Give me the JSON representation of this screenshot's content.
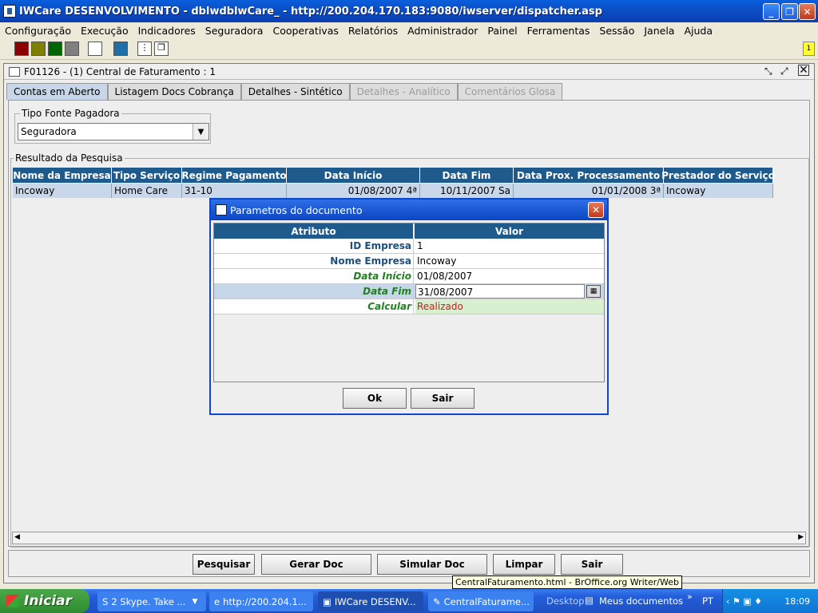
{
  "window": {
    "title": "IWCare DESENVOLVIMENTO - dblwdblwCare_ - http://200.204.170.183:9080/iwserver/dispatcher.asp"
  },
  "menu": [
    "Configuração",
    "Execução",
    "Indicadores",
    "Seguradora",
    "Cooperativas",
    "Relatórios",
    "Administrador",
    "Painel",
    "Ferramentas",
    "Sessão",
    "Janela",
    "Ajuda"
  ],
  "toolbar": {
    "badge": "1",
    "colors": [
      "#8b0000",
      "#808000",
      "#006400",
      "#808080",
      "#ffffff",
      "#1e6fa8"
    ]
  },
  "frame": {
    "title": "F01126 - (1) Central de Faturamento : 1"
  },
  "tabs": [
    {
      "label": "Contas em Aberto",
      "state": "active"
    },
    {
      "label": "Listagem Docs Cobrança",
      "state": "enabled"
    },
    {
      "label": "Detalhes - Sintético",
      "state": "enabled"
    },
    {
      "label": "Detalhes - Analítico",
      "state": "disabled"
    },
    {
      "label": "Comentários Glosa",
      "state": "disabled"
    }
  ],
  "filter": {
    "group_label": "Tipo Fonte Pagadora",
    "value": "Seguradora"
  },
  "results": {
    "group_label": "Resultado da Pesquisa",
    "columns": [
      "Nome da Empresa",
      "Tipo Serviço",
      "Regime Pagamento",
      "Data Início",
      "Data Fim",
      "Data Prox. Processamento",
      "Prestador do Serviço"
    ],
    "rows": [
      [
        "Incoway",
        "Home Care",
        "31-10",
        "01/08/2007 4ª",
        "10/11/2007 Sa",
        "01/01/2008 3ª",
        "Incoway"
      ]
    ]
  },
  "buttons": {
    "search": "Pesquisar",
    "generate": "Gerar Doc",
    "simulate": "Simular Doc",
    "clear": "Limpar",
    "exit": "Sair"
  },
  "dialog": {
    "title": "Parametros do documento",
    "columns": [
      "Atributo",
      "Valor"
    ],
    "rows": [
      {
        "label": "ID Empresa",
        "value": "1"
      },
      {
        "label": "Nome Empresa",
        "value": "Incoway"
      },
      {
        "label": "Data Início",
        "value": "01/08/2007"
      },
      {
        "label": "Data Fim",
        "value": "31/08/2007"
      },
      {
        "label": "Calcular",
        "value": "Realizado"
      }
    ],
    "ok": "Ok",
    "exit": "Sair"
  },
  "tooltip": "CentralFaturamento.html - BrOffice.org Writer/Web",
  "taskbar": {
    "start": "Iniciar",
    "tasks": [
      "2 Skype. Take ...",
      "http://200.204.1...",
      "IWCare DESENV...",
      "CentralFaturame..."
    ],
    "desktop": "Desktop",
    "docs": "Meus documentos",
    "lang": "PT",
    "clock": "18:09"
  }
}
